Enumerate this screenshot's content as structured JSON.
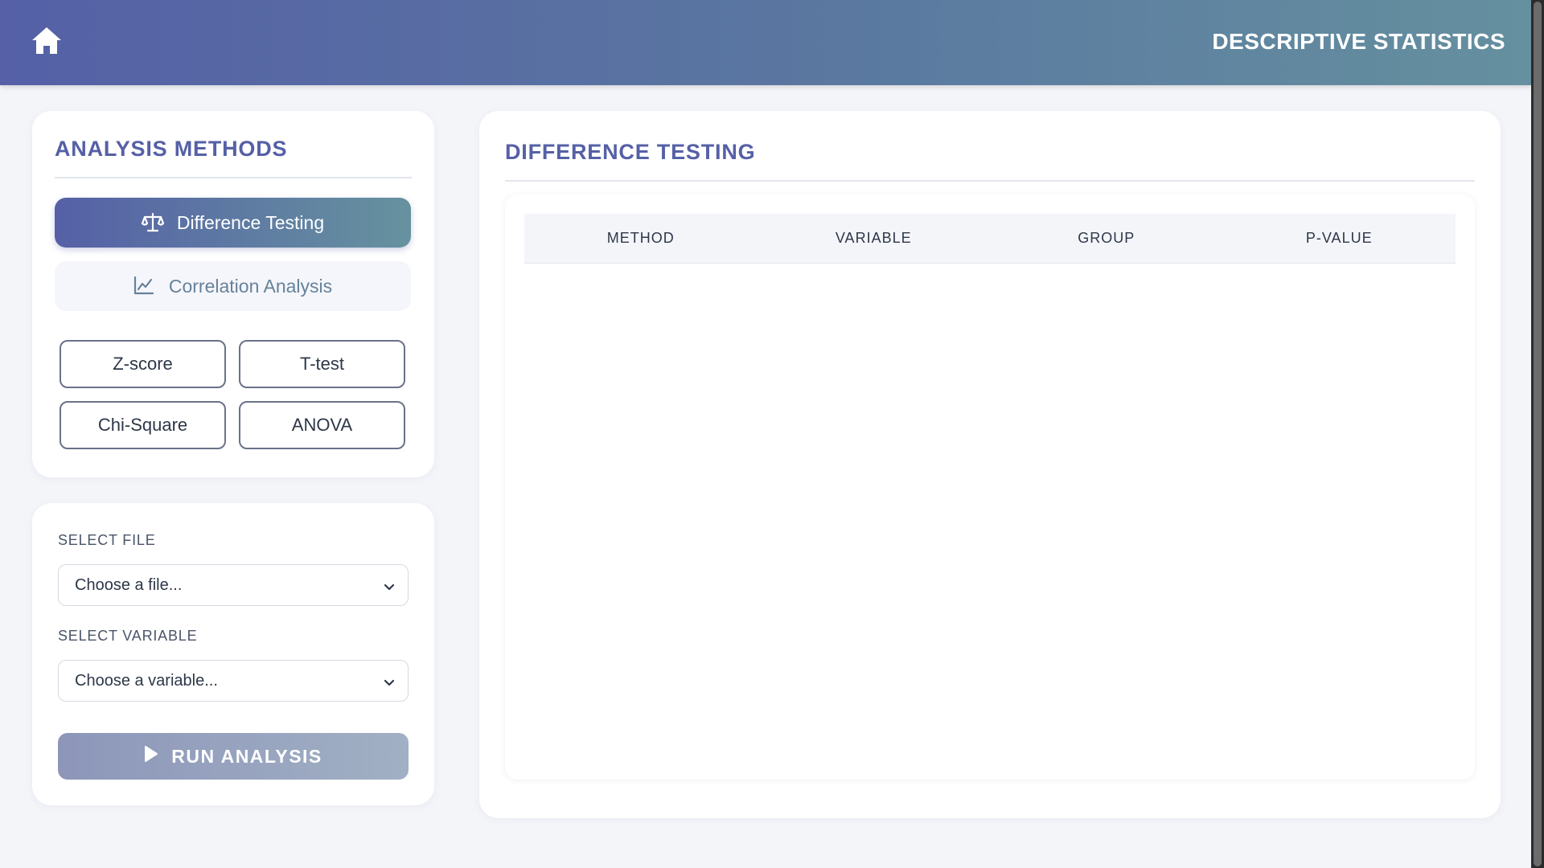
{
  "header": {
    "title": "DESCRIPTIVE STATISTICS",
    "home_icon": "home-icon"
  },
  "methods_panel": {
    "title": "ANALYSIS METHODS",
    "tabs": [
      {
        "label": "Difference Testing",
        "icon": "balance-scale-icon",
        "active": true
      },
      {
        "label": "Correlation Analysis",
        "icon": "line-chart-icon",
        "active": false
      }
    ],
    "tests": [
      "Z-score",
      "T-test",
      "Chi-Square",
      "ANOVA"
    ]
  },
  "selection_panel": {
    "file_label": "SELECT FILE",
    "file_value": "Choose a file...",
    "variable_label": "SELECT VARIABLE",
    "variable_value": "Choose a variable...",
    "run_label": "RUN ANALYSIS"
  },
  "results_panel": {
    "title": "DIFFERENCE TESTING",
    "columns": [
      "METHOD",
      "VARIABLE",
      "GROUP",
      "P-VALUE"
    ],
    "rows": []
  },
  "colors": {
    "primary": "#5560a6",
    "secondary": "#66929f",
    "background": "#f4f5f9"
  }
}
